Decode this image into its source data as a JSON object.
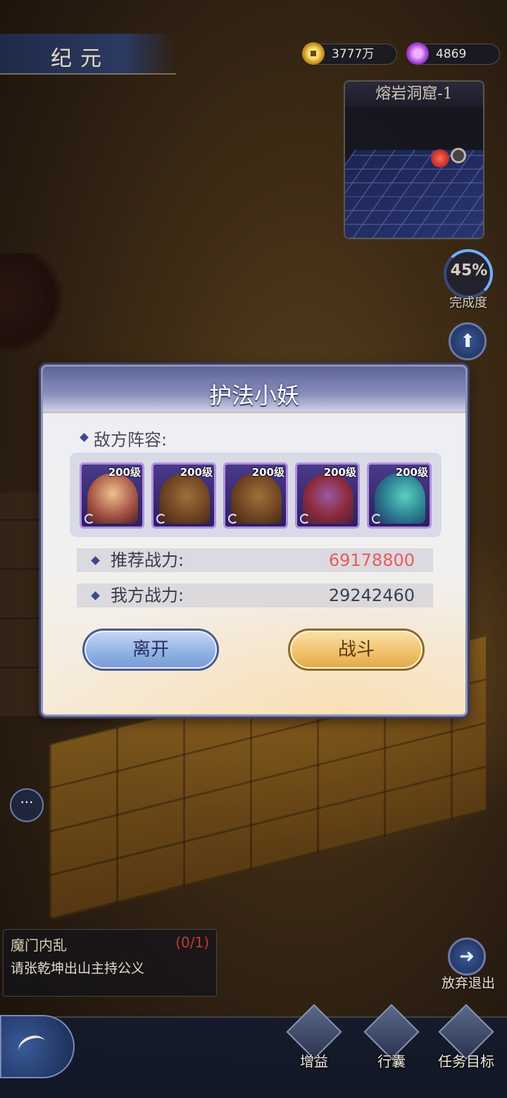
{
  "header": {
    "title": "纪元",
    "gold": "3777万",
    "gems": "4869"
  },
  "minimap": {
    "title": "熔岩洞窟-1"
  },
  "completion": {
    "percent": "45%",
    "label": "完成度"
  },
  "dialog": {
    "title": "护法小妖",
    "roster_label": "敌方阵容:",
    "enemies": [
      {
        "level": "200级",
        "icon": "bearded-warrior-portrait"
      },
      {
        "level": "200级",
        "icon": "rock-golem-portrait"
      },
      {
        "level": "200级",
        "icon": "rock-golem-portrait"
      },
      {
        "level": "200级",
        "icon": "horned-demon-portrait"
      },
      {
        "level": "200级",
        "icon": "sea-dragon-portrait"
      }
    ],
    "recommended_label": "推荐战力:",
    "recommended_value": "69178800",
    "my_label": "我方战力:",
    "my_value": "29242460",
    "leave_label": "离开",
    "fight_label": "战斗"
  },
  "quest": {
    "title": "魔门内乱",
    "count": "(0/1)",
    "desc": "请张乾坤出山主持公义"
  },
  "exit": {
    "label": "放弃退出"
  },
  "bottom_nav": {
    "buff": "增益",
    "bag": "行囊",
    "goal": "任务目标"
  },
  "colors": {
    "recommended_power": "#e85a5a",
    "leave_button": "#8fb0e4",
    "fight_button": "#f0c068"
  }
}
